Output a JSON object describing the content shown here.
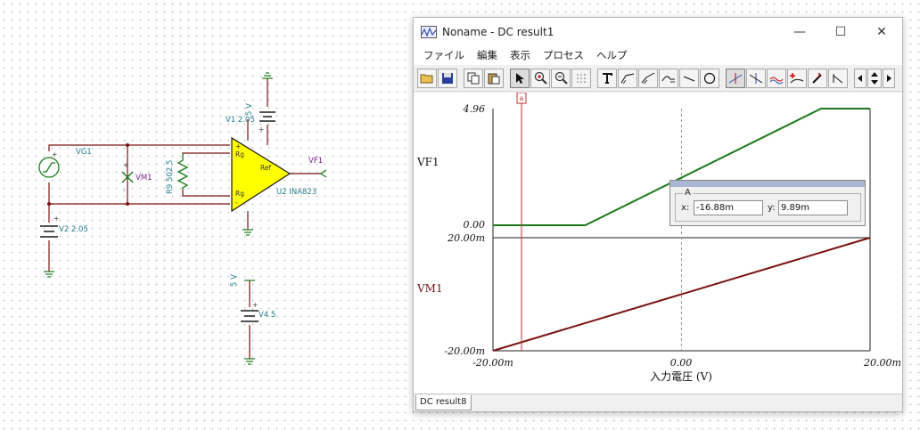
{
  "schematic": {
    "vg1_label": "VG1",
    "vm1_label": "VM1",
    "r9_label": "R9 502.5",
    "v1_label": "V1 2.05",
    "v1_volt": "5 V",
    "u2_label": "U2 INA823",
    "vf1_label": "VF1",
    "v2_label": "V2 2.05",
    "v4_label": "V4 5",
    "v4_volt": "5 V",
    "pin_rg_top": "Rg",
    "pin_rg_bottom": "Rg",
    "pin_ref": "Ref",
    "plus": "+",
    "minus": "-"
  },
  "window": {
    "title": "Noname - DC result1",
    "minimize": "—",
    "maximize": "☐",
    "close": "✕",
    "menu": [
      "ファイル",
      "編集",
      "表示",
      "プロセス",
      "ヘルプ"
    ]
  },
  "toolbar": {
    "icons": [
      "open-folder-icon",
      "save-icon",
      "copy-icon",
      "paste-icon",
      "pointer-icon",
      "zoom-in-icon",
      "zoom-100-icon",
      "grid-icon",
      "text-icon",
      "curve-a-icon",
      "curve-b-icon",
      "curve-c-icon",
      "line-icon",
      "circle-icon",
      "cursor-a-icon",
      "cursor-b-icon",
      "marker-icon",
      "marker-add-icon",
      "pen-icon",
      "angle-icon",
      "left-arrow-icon",
      "up-down-arrow-icon",
      "right-arrow-icon"
    ]
  },
  "cursor": {
    "group_title": "A",
    "x_label": "x:",
    "x_value": "-16.88m",
    "y_label": "y:",
    "y_value": "9.89m",
    "marker_label": "a"
  },
  "status": {
    "tab_label": "DC result8"
  },
  "chart_data": [
    {
      "type": "line",
      "title": "",
      "ylabel": "VF1",
      "xlabel": "",
      "xlim": [
        -20,
        20
      ],
      "ylim": [
        0,
        4.96
      ],
      "ytick_labels": [
        "0.00",
        "4.96"
      ],
      "grid": "vertical dashed at x=0",
      "series": [
        {
          "name": "VF1",
          "color": "#1a7a1a",
          "x": [
            -20,
            -10.2,
            14.8,
            20
          ],
          "y": [
            0,
            0,
            4.96,
            4.96
          ]
        }
      ]
    },
    {
      "type": "line",
      "title": "",
      "ylabel": "VM1",
      "xlabel": "入力電圧 (V)",
      "xlim": [
        -20,
        20
      ],
      "ylim": [
        -20,
        20
      ],
      "ytick_labels": [
        "-20.00m",
        "20.00m"
      ],
      "xtick_labels": [
        "-20.00m",
        "0.00",
        "20.00m"
      ],
      "grid": "vertical dashed at x=0",
      "series": [
        {
          "name": "VM1",
          "color": "#7a1010",
          "x": [
            -20,
            20
          ],
          "y": [
            -20,
            20
          ]
        }
      ]
    }
  ]
}
